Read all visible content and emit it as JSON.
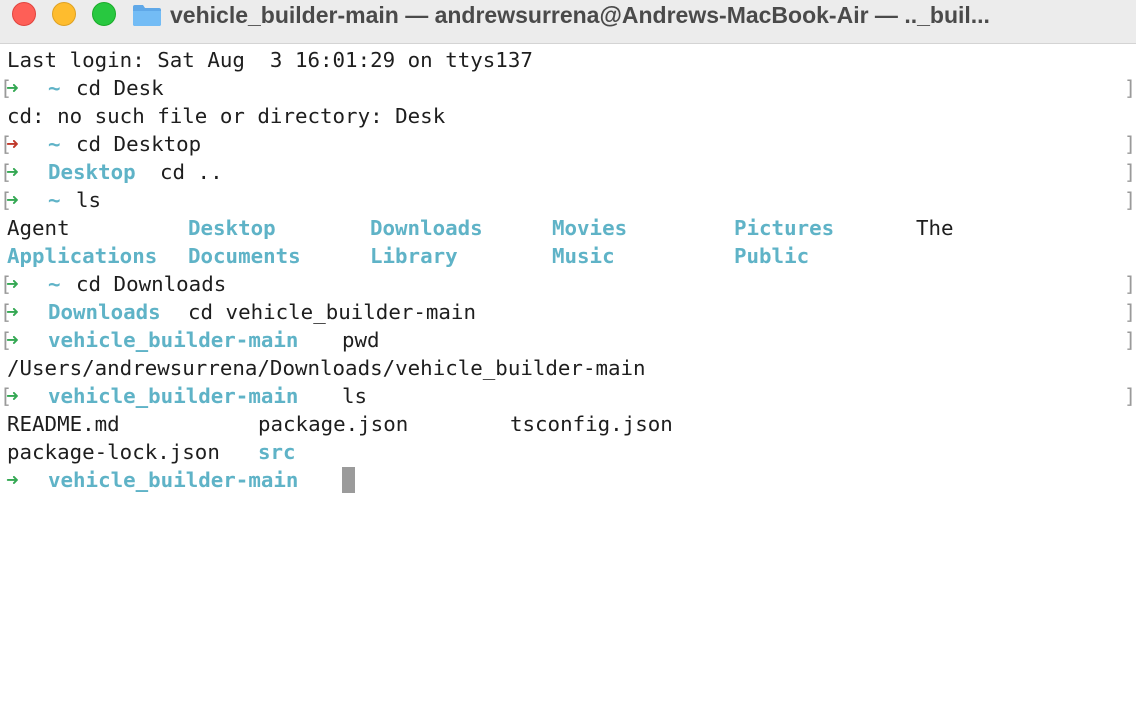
{
  "window": {
    "title": "vehicle_builder-main — andrewsurrena@Andrews-MacBook-Air — .._buil..."
  },
  "terminal": {
    "last_login": "Last login: Sat Aug  3 16:01:29 on ttys137",
    "arrow": "➜",
    "bracket_open": "[",
    "bracket_close": "]",
    "prompt_home": "~",
    "cmd1": "cd Desk",
    "err1": "cd: no such file or directory: Desk",
    "cmd2": "cd Desktop",
    "dir_desktop": "Desktop",
    "cmd3": "cd ..",
    "cmd4": "ls",
    "ls_home": {
      "r1c1": "Agent",
      "r1c2": "Desktop",
      "r1c3": "Downloads",
      "r1c4": "Movies",
      "r1c5": "Pictures",
      "r1c6": "The",
      "r2c1": "Applications",
      "r2c2": "Documents",
      "r2c3": "Library",
      "r2c4": "Music",
      "r2c5": "Public"
    },
    "cmd5": "cd Downloads",
    "dir_downloads": "Downloads",
    "cmd6": "cd vehicle_builder-main",
    "dir_project": "vehicle_builder-main",
    "cmd7": "pwd",
    "pwd_output": "/Users/andrewsurrena/Downloads/vehicle_builder-main",
    "cmd8": "ls",
    "ls_project": {
      "r1c1": "README.md",
      "r1c2": "package.json",
      "r1c3": "tsconfig.json",
      "r2c1": "package-lock.json",
      "r2c2": "src"
    }
  },
  "colors": {
    "arrow_ok": "#34a853",
    "arrow_error": "#c0392b",
    "directory": "#5fb3c7",
    "cursor": "#9b9b9b"
  }
}
